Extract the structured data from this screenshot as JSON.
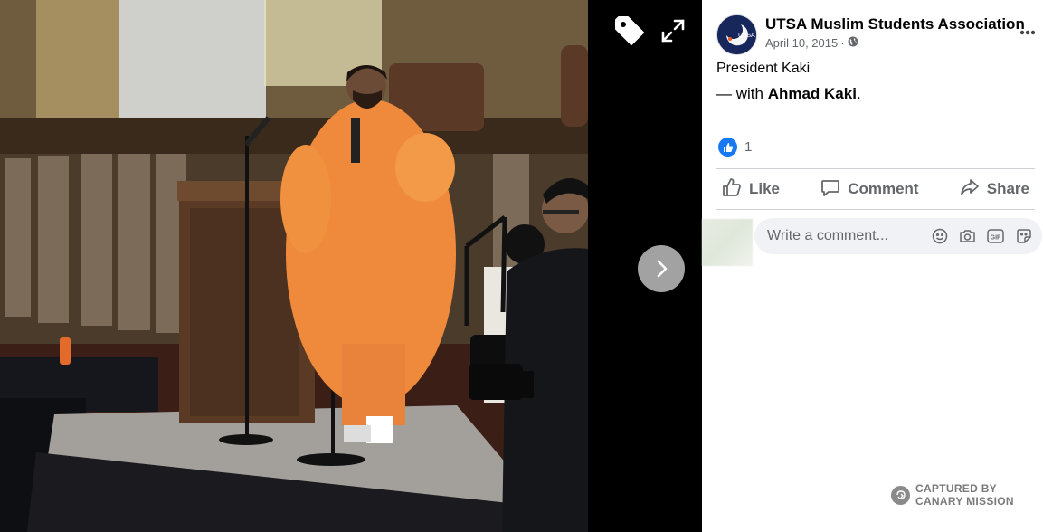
{
  "viewer": {
    "tag_icon": "tag-icon",
    "expand_icon": "expand-icon",
    "next_icon": "chevron-right-icon"
  },
  "post": {
    "page_name": "UTSA Muslim Students Association",
    "date": "April 10, 2015",
    "separator": "·",
    "privacy_icon": "globe-icon",
    "avatar_text": "UTSA",
    "more_icon": "more-horizontal-icon",
    "caption": "President Kaki",
    "with_prefix": "— with ",
    "tagged_person": "Ahmad Kaki",
    "with_suffix": "."
  },
  "reactions": {
    "icon": "thumbs-up-icon",
    "count": "1"
  },
  "actions": {
    "like": "Like",
    "comment": "Comment",
    "share": "Share"
  },
  "comment": {
    "placeholder": "Write a comment...",
    "tools": [
      "emoji-icon",
      "camera-icon",
      "gif-icon",
      "sticker-icon"
    ],
    "gif_label": "GIF"
  },
  "watermark": {
    "line1": "CAPTURED BY",
    "line2": "CANARY MISSION"
  },
  "colors": {
    "accent": "#1877f2",
    "secondary_text": "#65676b",
    "viewer_bg": "#000000",
    "comment_bg": "#f0f2f5"
  }
}
